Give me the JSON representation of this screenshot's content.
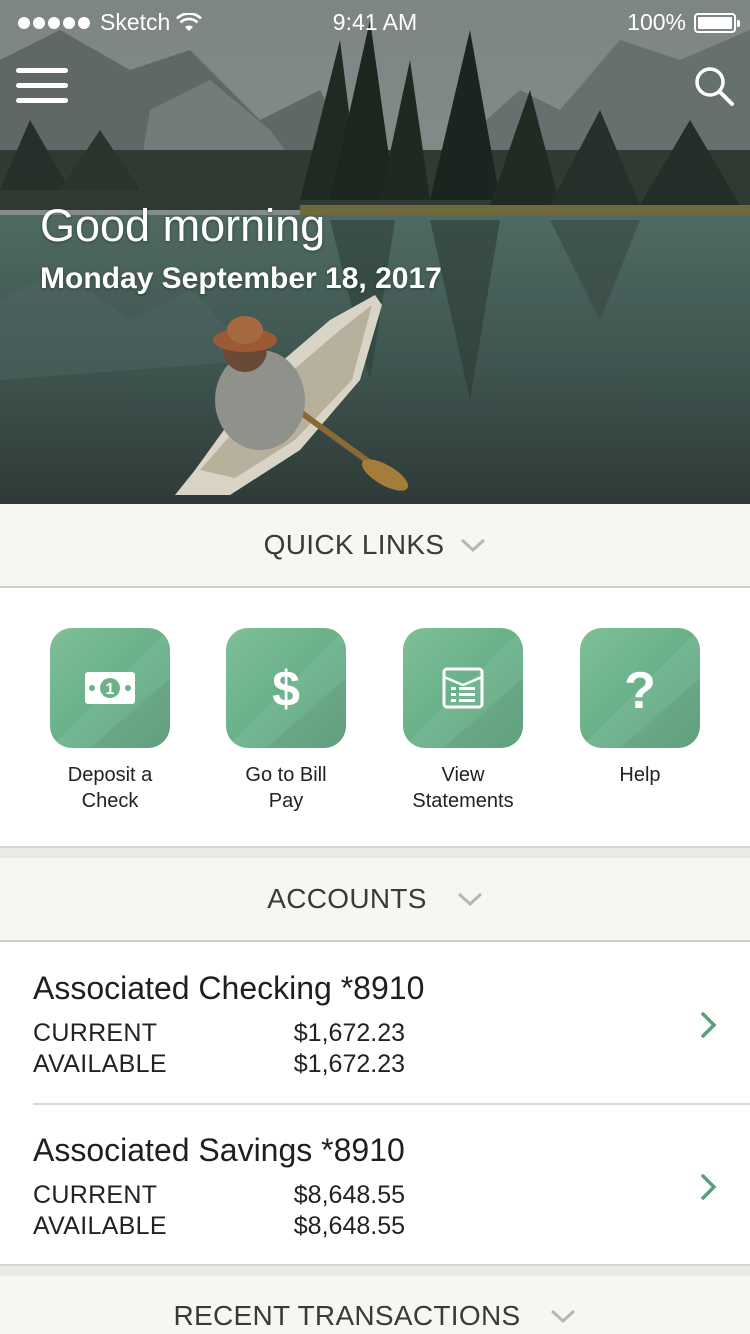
{
  "status_bar": {
    "carrier": "Sketch",
    "time": "9:41 AM",
    "battery": "100%"
  },
  "hero": {
    "greeting": "Good morning",
    "date": "Monday September 18, 2017"
  },
  "quick_links": {
    "title": "QUICK LINKS",
    "items": [
      {
        "label_line1": "Deposit a",
        "label_line2": "Check",
        "icon": "banknote-icon"
      },
      {
        "label_line1": "Go to Bill",
        "label_line2": "Pay",
        "icon": "dollar-icon"
      },
      {
        "label_line1": "View",
        "label_line2": "Statements",
        "icon": "statement-icon"
      },
      {
        "label_line1": "Help",
        "label_line2": "",
        "icon": "question-icon"
      }
    ]
  },
  "accounts": {
    "title": "ACCOUNTS",
    "items": [
      {
        "name": "Associated Checking *8910",
        "current_label": "CURRENT",
        "current_value": "$1,672.23",
        "available_label": "AVAILABLE",
        "available_value": "$1,672.23"
      },
      {
        "name": "Associated Savings *8910",
        "current_label": "CURRENT",
        "current_value": "$8,648.55",
        "available_label": "AVAILABLE",
        "available_value": "$8,648.55"
      }
    ]
  },
  "recent_transactions": {
    "title": "RECENT TRANSACTIONS"
  },
  "colors": {
    "accent_green": "#6bb28b",
    "chevron_green": "#5a9e7a",
    "section_bg": "#f6f6f2"
  }
}
